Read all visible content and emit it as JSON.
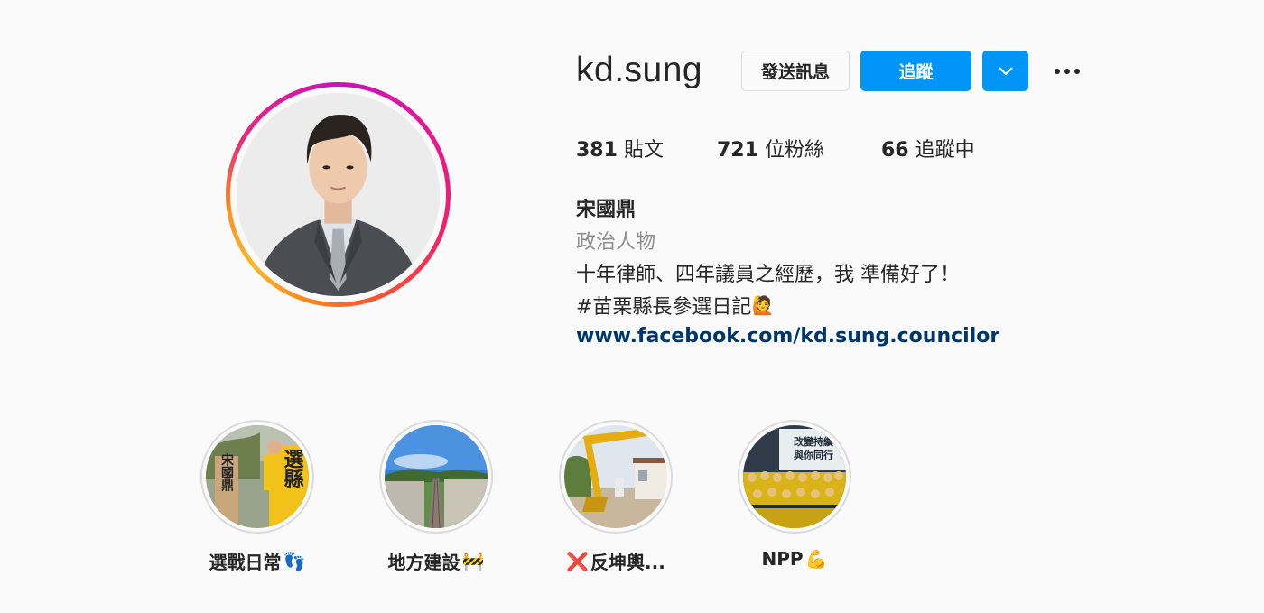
{
  "profile": {
    "username": "kd.sung",
    "buttons": {
      "message": "發送訊息",
      "follow": "追蹤",
      "dropdown_icon": "chevron-down-icon",
      "more_icon": "more-options-icon"
    },
    "stats": {
      "posts_count": "381",
      "posts_label": "貼文",
      "followers_count": "721",
      "followers_label": "位粉絲",
      "following_count": "66",
      "following_label": "追蹤中"
    },
    "bio": {
      "name": "宋國鼎",
      "category": "政治人物",
      "line1": "十年律師、四年議員之經歷，我 準備好了！",
      "line2": "#苗栗縣長參選日記",
      "line2_emoji": "🙋",
      "link": "www.facebook.com/kd.sung.councilor"
    },
    "story_ring_colors": [
      "#c913b9",
      "#e6198f",
      "#f7532f",
      "#fcb827"
    ]
  },
  "highlights": [
    {
      "label": "選戰日常",
      "emoji": "👣"
    },
    {
      "label": "地方建設",
      "emoji": "🚧"
    },
    {
      "label": "反坤輿...",
      "emoji_before": "❌"
    },
    {
      "label": "NPP",
      "emoji": "💪"
    }
  ],
  "highlight_image_text": {
    "h1_sign_a": "宋國鼎",
    "h1_sign_b": "選縣",
    "h4_banner_a": "改變持續",
    "h4_banner_b": "與你同行"
  },
  "colors": {
    "accent": "#0095f6",
    "link": "#00376b",
    "text": "#262626",
    "muted": "#8e8e8e",
    "background": "#fafafa"
  }
}
